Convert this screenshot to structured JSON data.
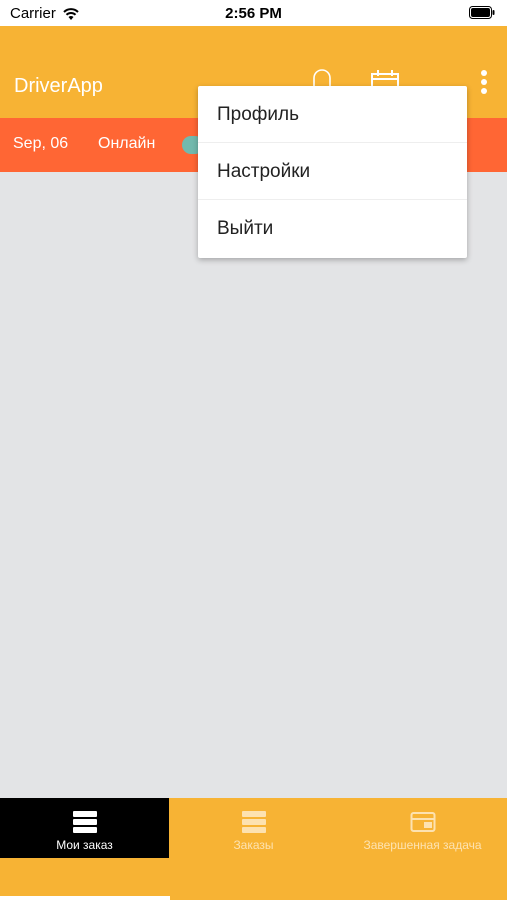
{
  "status_bar": {
    "carrier": "Carrier",
    "time": "2:56 PM"
  },
  "app_bar": {
    "title": "DriverApp"
  },
  "sub_bar": {
    "date": "Sep, 06",
    "online": "Онлайн"
  },
  "menu": {
    "items": [
      "Профиль",
      "Настройки",
      "Выйти"
    ]
  },
  "tab_bar": {
    "tabs": [
      {
        "label": "Мои заказ",
        "icon": "list-icon",
        "active": true
      },
      {
        "label": "Заказы",
        "icon": "list-icon",
        "active": false
      },
      {
        "label": "Завершенная задача",
        "icon": "card-icon",
        "active": false
      }
    ]
  },
  "colors": {
    "primary": "#f7b334",
    "accent": "#ff6634",
    "toggle": "#72b9ad",
    "background": "#e3e4e6"
  }
}
